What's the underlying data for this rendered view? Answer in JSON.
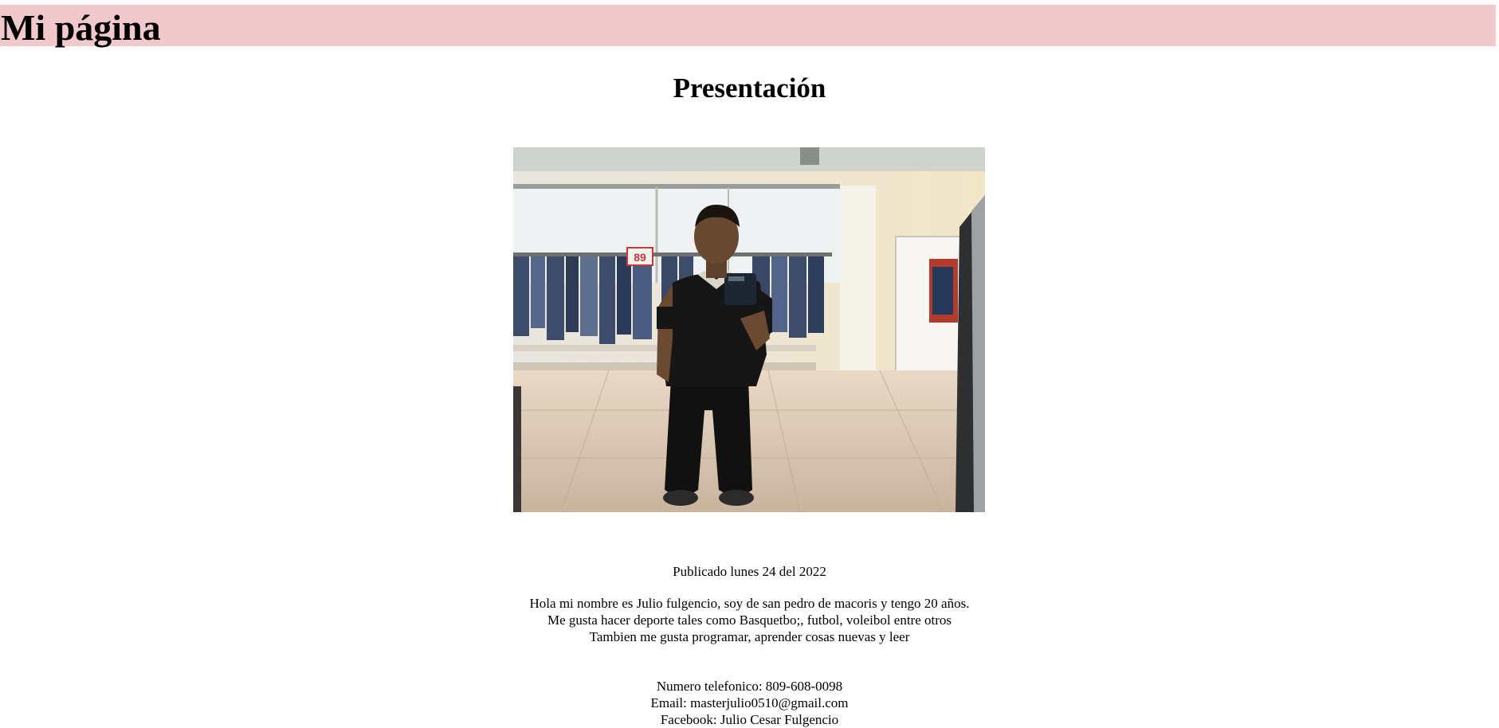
{
  "header": {
    "title": "Mi página",
    "background_color": "#f2c9ca"
  },
  "main": {
    "heading": "Presentación",
    "photo": {
      "description_icon": "profile-photo",
      "tag_text": "89"
    },
    "published": "Publicado lunes 24 del 2022",
    "bio_lines": [
      "Hola mi nombre es Julio fulgencio, soy de san pedro de macoris y tengo 20 años.",
      "Me gusta hacer deporte tales como Basquetbo;, futbol, voleibol entre otros",
      "Tambien me gusta programar, aprender cosas nuevas y leer"
    ],
    "contact_lines": [
      "Numero telefonico: 809-608-0098",
      "Email: masterjulio0510@gmail.com",
      "Facebook: Julio Cesar Fulgencio"
    ]
  }
}
